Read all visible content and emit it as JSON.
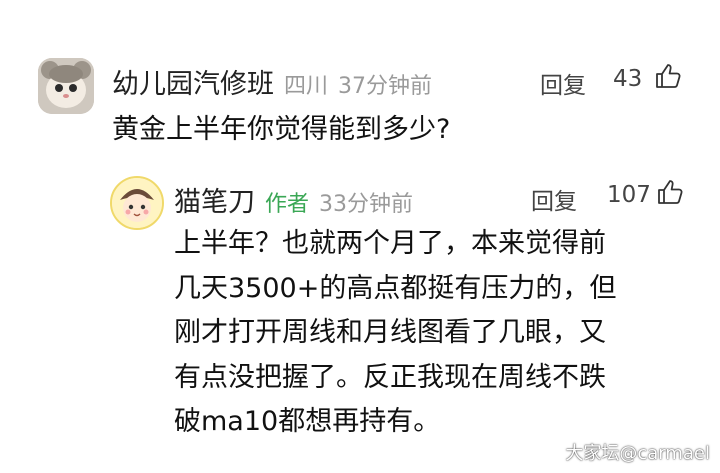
{
  "comment": {
    "username": "幼儿园汽修班",
    "location": "四川",
    "time": "37分钟前",
    "reply_label": "回复",
    "likes": "43",
    "text": "黄金上半年你觉得能到多少?"
  },
  "reply": {
    "username": "猫笔刀",
    "badge": "作者",
    "time": "33分钟前",
    "reply_label": "回复",
    "likes": "107",
    "lines": [
      "上半年？也就两个月了，本来觉得前",
      "几天3500+的高点都挺有压力的，但",
      "刚才打开周线和月线图看了几眼，又",
      "有点没把握了。反正我现在周线不跌",
      "破ma10都想再持有。"
    ]
  },
  "watermark": "大家坛@carmael"
}
